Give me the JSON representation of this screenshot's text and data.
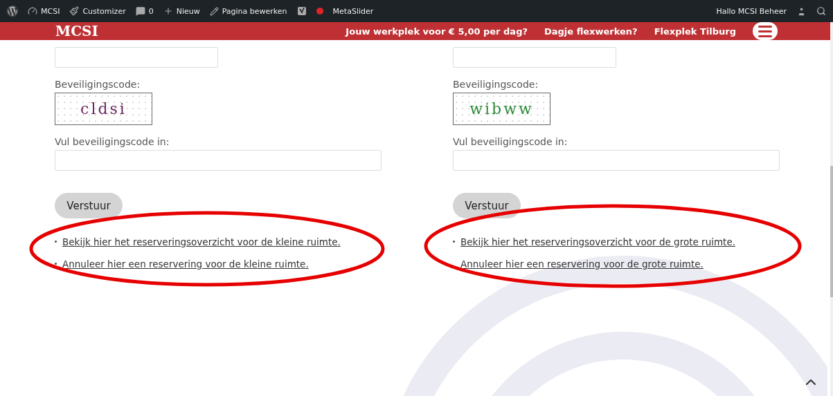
{
  "admin_bar": {
    "items": [
      {
        "kind": "wp-logo"
      },
      {
        "kind": "dashboard",
        "label": "MCSI"
      },
      {
        "kind": "brush",
        "label": "Customizer"
      },
      {
        "kind": "comment",
        "label": "0"
      },
      {
        "kind": "plus",
        "label": "Nieuw"
      },
      {
        "kind": "pencil",
        "label": "Pagina bewerken"
      },
      {
        "kind": "seo"
      },
      {
        "kind": "dot",
        "color": "#e02424"
      },
      {
        "kind": "text",
        "label": "MetaSlider"
      }
    ],
    "greeting": "Hallo MCSI Beheer"
  },
  "header": {
    "logo": "MCSI",
    "nav": [
      "Jouw werkplek voor € 5,00 per dag?",
      "Dagje flexwerken?",
      "Flexplek Tilburg"
    ]
  },
  "forms": [
    {
      "captcha_label": "Beveiligingscode:",
      "captcha_text": "cldsi",
      "code_label": "Vul beveiligingscode in:",
      "submit": "Verstuur",
      "links": [
        {
          "text": "Bekijk hier het reserveringsoverzicht voor de kleine ruimte.",
          "bullet": true
        },
        {
          "text": "Annuleer hier een reservering voor de kleine ruimte.",
          "bullet": true
        }
      ]
    },
    {
      "captcha_label": "Beveiligingscode:",
      "captcha_text": "wibww",
      "code_label": "Vul beveiligingscode in:",
      "submit": "Verstuur",
      "links": [
        {
          "text": "Bekijk hier het reserveringsoverzicht voor de grote ruimte.",
          "bullet": true
        },
        {
          "text": "Annuleer hier een reservering voor de grote ruimte.",
          "bullet": false
        }
      ]
    }
  ]
}
